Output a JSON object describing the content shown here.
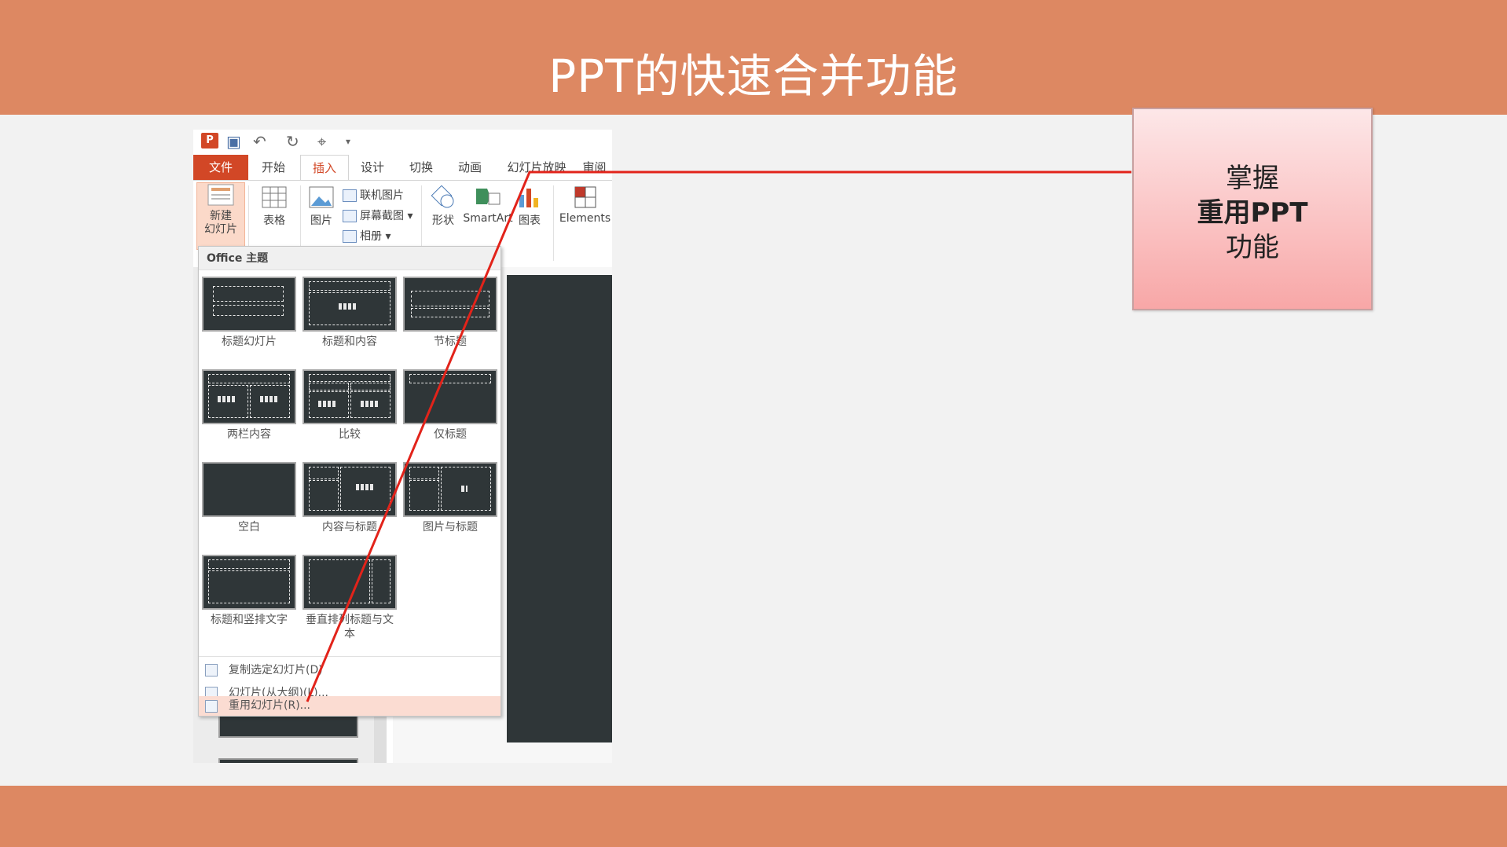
{
  "slide": {
    "title": "PPT的快速合并功能"
  },
  "window": {
    "app_icon": "P",
    "qat": {
      "undo": "↶",
      "redo": "↻",
      "touch": "⌖",
      "more": "▾"
    },
    "tabs": [
      "文件",
      "开始",
      "插入",
      "设计",
      "切换",
      "动画",
      "幻灯片放映",
      "审阅"
    ],
    "active_tab": "插入"
  },
  "ribbon": {
    "new_slide": "新建\n幻灯片",
    "table": "表格",
    "picture": "图片",
    "online_picture": "联机图片",
    "screenshot": "屏幕截图",
    "album": "相册",
    "shapes": "形状",
    "smartart": "SmartArt",
    "chart": "图表",
    "elements": "Elements"
  },
  "gallery": {
    "header": "Office 主题",
    "layouts": [
      {
        "name": "标题幻灯片"
      },
      {
        "name": "标题和内容"
      },
      {
        "name": "节标题"
      },
      {
        "name": "两栏内容"
      },
      {
        "name": "比较"
      },
      {
        "name": "仅标题"
      },
      {
        "name": "空白"
      },
      {
        "name": "内容与标题"
      },
      {
        "name": "图片与标题"
      },
      {
        "name": "标题和竖排文字"
      },
      {
        "name": "垂直排列标题与文本"
      }
    ],
    "menu": [
      {
        "label": "复制选定幻灯片(D)"
      },
      {
        "label": "幻灯片(从大纲)(L)..."
      },
      {
        "label": "重用幻灯片(R)..."
      }
    ]
  },
  "callout": {
    "line1": "掌握",
    "line2": "重用PPT",
    "line3": "功能"
  },
  "colors": {
    "band": "#dd8862",
    "accent": "#d24726",
    "arrow": "#e2231a"
  }
}
